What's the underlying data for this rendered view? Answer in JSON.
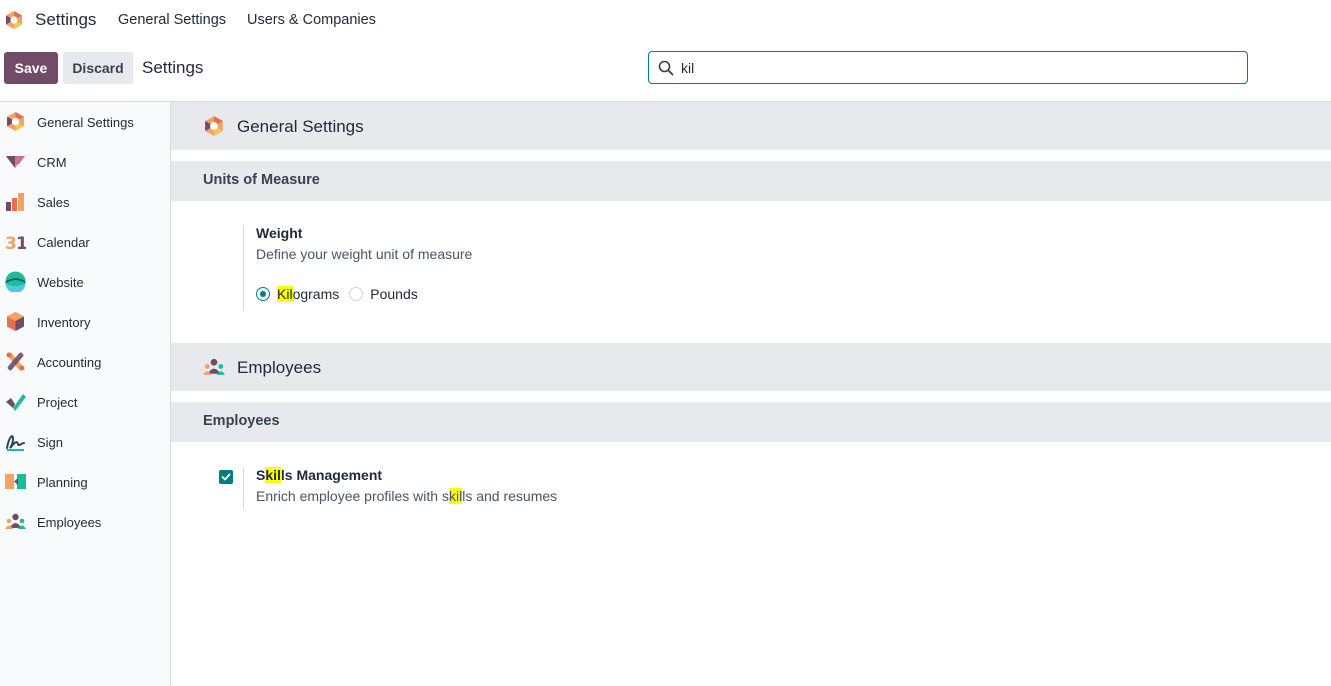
{
  "topbar": {
    "app_name": "Settings",
    "menu": [
      "General Settings",
      "Users & Companies"
    ]
  },
  "control_panel": {
    "save_label": "Save",
    "discard_label": "Discard",
    "title": "Settings",
    "search_value": "kil",
    "accent_color": "#714b67",
    "focus_color": "#017e84"
  },
  "sidebar": {
    "items": [
      {
        "label": "General Settings",
        "icon": "general-settings-icon"
      },
      {
        "label": "CRM",
        "icon": "crm-icon"
      },
      {
        "label": "Sales",
        "icon": "sales-icon"
      },
      {
        "label": "Calendar",
        "icon": "calendar-icon"
      },
      {
        "label": "Website",
        "icon": "website-icon"
      },
      {
        "label": "Inventory",
        "icon": "inventory-icon"
      },
      {
        "label": "Accounting",
        "icon": "accounting-icon"
      },
      {
        "label": "Project",
        "icon": "project-icon"
      },
      {
        "label": "Sign",
        "icon": "sign-icon"
      },
      {
        "label": "Planning",
        "icon": "planning-icon"
      },
      {
        "label": "Employees",
        "icon": "employees-icon"
      }
    ]
  },
  "main": {
    "general": {
      "title": "General Settings",
      "section_title": "Units of Measure",
      "setting_name": "Weight",
      "setting_desc": "Define your weight unit of measure",
      "options": {
        "kg_highlight": "Kil",
        "kg_rest": "ograms",
        "lb": "Pounds",
        "selected": "Kilograms"
      }
    },
    "employees": {
      "title": "Employees",
      "section_title": "Employees",
      "setting_name_pre": "S",
      "setting_name_hl": "kil",
      "setting_name_post": "ls Management",
      "setting_desc_pre": "Enrich employee profiles with s",
      "setting_desc_hl": "kil",
      "setting_desc_post": "ls and resumes",
      "checked": true
    }
  }
}
